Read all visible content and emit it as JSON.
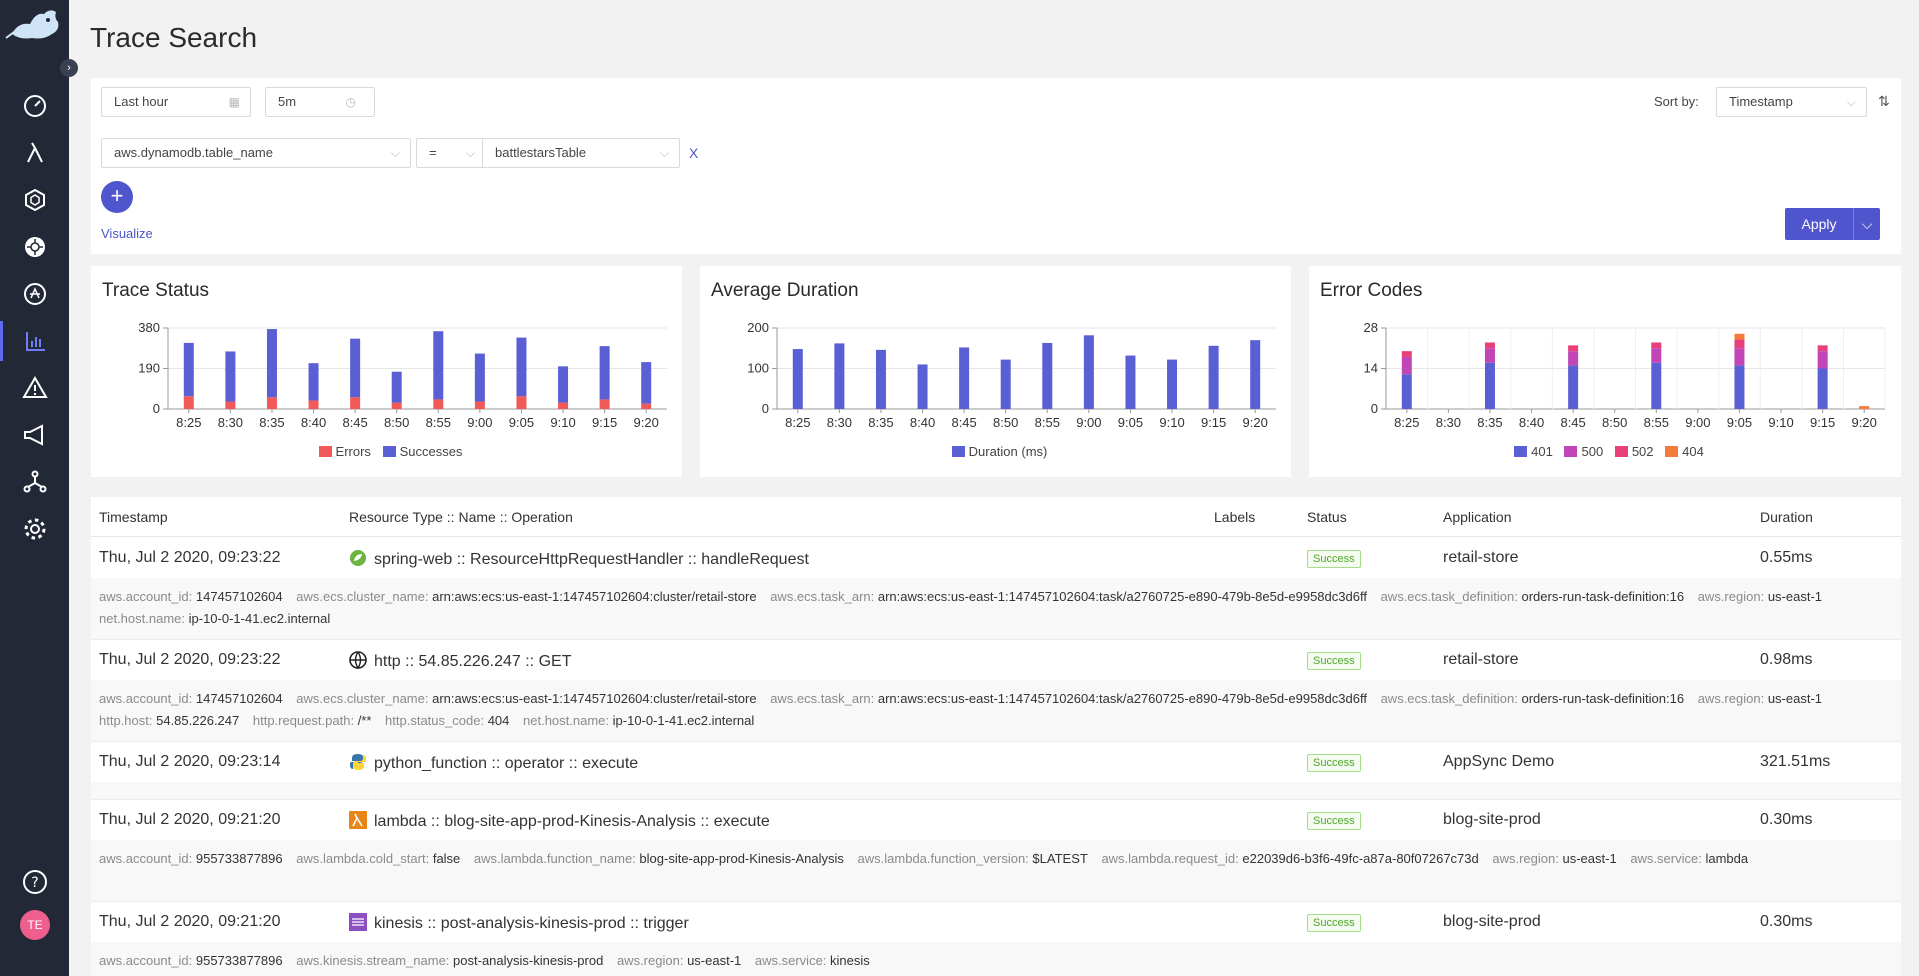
{
  "page": {
    "title": "Trace Search"
  },
  "filters": {
    "time_range": "Last hour",
    "interval": "5m",
    "sort_label": "Sort by:",
    "sort_value": "Timestamp",
    "attribute": "aws.dynamodb.table_name",
    "operator": "=",
    "value": "battlestarsTable",
    "clear": "X",
    "visualize_label": "Visualize",
    "apply_label": "Apply"
  },
  "user": {
    "initials": "TE"
  },
  "colors": {
    "accent": "#4f55cc",
    "errors": "#f25a5a",
    "successes": "#5b5fd4",
    "c401": "#5b5fd4",
    "c500": "#c145b6",
    "c502": "#e8407a",
    "c404": "#f47b3a"
  },
  "charts": {
    "times": [
      "8:25",
      "8:30",
      "8:35",
      "8:40",
      "8:45",
      "8:50",
      "8:55",
      "9:00",
      "9:05",
      "9:10",
      "9:15",
      "9:20"
    ],
    "trace_status": {
      "title": "Trace Status",
      "yticks": [
        "380",
        "190",
        "0"
      ],
      "legend": [
        "Errors",
        "Successes"
      ]
    },
    "avg_duration": {
      "title": "Average Duration",
      "yticks": [
        "200",
        "100",
        "0"
      ],
      "legend": [
        "Duration (ms)"
      ]
    },
    "error_codes": {
      "title": "Error Codes",
      "yticks": [
        "28",
        "14",
        "0"
      ],
      "legend": [
        "401",
        "500",
        "502",
        "404"
      ]
    }
  },
  "chart_data": [
    {
      "type": "bar",
      "title": "Trace Status",
      "categories": [
        "8:25",
        "8:30",
        "8:35",
        "8:40",
        "8:45",
        "8:50",
        "8:55",
        "9:00",
        "9:05",
        "9:10",
        "9:15",
        "9:20"
      ],
      "series": [
        {
          "name": "Errors",
          "values": [
            60,
            35,
            55,
            40,
            55,
            30,
            45,
            35,
            60,
            30,
            45,
            25
          ]
        },
        {
          "name": "Successes",
          "values": [
            250,
            235,
            320,
            175,
            275,
            145,
            320,
            225,
            275,
            170,
            250,
            195
          ]
        }
      ],
      "ylim": [
        0,
        380
      ]
    },
    {
      "type": "bar",
      "title": "Average Duration",
      "categories": [
        "8:25",
        "8:30",
        "8:35",
        "8:40",
        "8:45",
        "8:50",
        "8:55",
        "9:00",
        "9:05",
        "9:10",
        "9:15",
        "9:20"
      ],
      "series": [
        {
          "name": "Duration (ms)",
          "values": [
            148,
            162,
            146,
            110,
            152,
            122,
            163,
            182,
            132,
            122,
            156,
            170
          ]
        }
      ],
      "ylim": [
        0,
        200
      ]
    },
    {
      "type": "bar",
      "title": "Error Codes",
      "categories": [
        "8:25",
        "8:30",
        "8:35",
        "8:40",
        "8:45",
        "8:50",
        "8:55",
        "9:00",
        "9:05",
        "9:10",
        "9:15",
        "9:20"
      ],
      "series": [
        {
          "name": "401",
          "values": [
            12,
            0,
            16,
            0,
            15,
            0,
            16,
            0,
            15,
            0,
            14,
            0
          ]
        },
        {
          "name": "500",
          "values": [
            6,
            0,
            5,
            0,
            5,
            0,
            5,
            0,
            6,
            0,
            6,
            0
          ]
        },
        {
          "name": "502",
          "values": [
            2,
            0,
            2,
            0,
            2,
            0,
            2,
            0,
            3,
            0,
            2,
            0
          ]
        },
        {
          "name": "404",
          "values": [
            0,
            0,
            0,
            0,
            0,
            0,
            0,
            0,
            2,
            0,
            0,
            1
          ]
        }
      ],
      "ylim": [
        0,
        28
      ]
    }
  ],
  "table": {
    "headers": [
      "Timestamp",
      "Resource Type :: Name :: Operation",
      "Labels",
      "Status",
      "Application",
      "Duration"
    ],
    "rows": [
      {
        "timestamp": "Thu, Jul 2 2020, 09:23:22",
        "resource": "spring-web :: ResourceHttpRequestHandler :: handleRequest",
        "icon": "spring-icon",
        "status": "Success",
        "application": "retail-store",
        "duration": "0.55ms",
        "tags": [
          {
            "k": "aws.account_id:",
            "v": "147457102604"
          },
          {
            "k": "aws.ecs.cluster_name:",
            "v": "arn:aws:ecs:us-east-1:147457102604:cluster/retail-store"
          },
          {
            "k": "aws.ecs.task_arn:",
            "v": "arn:aws:ecs:us-east-1:147457102604:task/a2760725-e890-479b-8e5d-e9958dc3d6ff"
          },
          {
            "k": "aws.ecs.task_definition:",
            "v": "orders-run-task-definition:16"
          },
          {
            "k": "aws.region:",
            "v": "us-east-1"
          },
          {
            "k": "net.host.name:",
            "v": "ip-10-0-1-41.ec2.internal"
          }
        ]
      },
      {
        "timestamp": "Thu, Jul 2 2020, 09:23:22",
        "resource": "http :: 54.85.226.247 :: GET",
        "icon": "globe-icon",
        "status": "Success",
        "application": "retail-store",
        "duration": "0.98ms",
        "tags": [
          {
            "k": "aws.account_id:",
            "v": "147457102604"
          },
          {
            "k": "aws.ecs.cluster_name:",
            "v": "arn:aws:ecs:us-east-1:147457102604:cluster/retail-store"
          },
          {
            "k": "aws.ecs.task_arn:",
            "v": "arn:aws:ecs:us-east-1:147457102604:task/a2760725-e890-479b-8e5d-e9958dc3d6ff"
          },
          {
            "k": "aws.ecs.task_definition:",
            "v": "orders-run-task-definition:16"
          },
          {
            "k": "aws.region:",
            "v": "us-east-1"
          },
          {
            "k": "http.host:",
            "v": "54.85.226.247"
          },
          {
            "k": "http.request.path:",
            "v": "/**"
          },
          {
            "k": "http.status_code:",
            "v": "404"
          },
          {
            "k": "net.host.name:",
            "v": "ip-10-0-1-41.ec2.internal"
          }
        ]
      },
      {
        "timestamp": "Thu, Jul 2 2020, 09:23:14",
        "resource": "python_function :: operator :: execute",
        "icon": "python-icon",
        "status": "Success",
        "application": "AppSync Demo",
        "duration": "321.51ms",
        "tags": []
      },
      {
        "timestamp": "Thu, Jul 2 2020, 09:21:20",
        "resource": "lambda :: blog-site-app-prod-Kinesis-Analysis :: execute",
        "icon": "lambda-icon",
        "status": "Success",
        "application": "blog-site-prod",
        "duration": "0.30ms",
        "tags": [
          {
            "k": "aws.account_id:",
            "v": "955733877896"
          },
          {
            "k": "aws.lambda.cold_start:",
            "v": "false"
          },
          {
            "k": "aws.lambda.function_name:",
            "v": "blog-site-app-prod-Kinesis-Analysis"
          },
          {
            "k": "aws.lambda.function_version:",
            "v": "$LATEST"
          },
          {
            "k": "aws.lambda.request_id:",
            "v": "e22039d6-b3f6-49fc-a87a-80f07267c73d"
          },
          {
            "k": "aws.region:",
            "v": "us-east-1"
          },
          {
            "k": "aws.service:",
            "v": "lambda"
          }
        ]
      },
      {
        "timestamp": "Thu, Jul 2 2020, 09:21:20",
        "resource": "kinesis :: post-analysis-kinesis-prod :: trigger",
        "icon": "kinesis-icon",
        "status": "Success",
        "application": "blog-site-prod",
        "duration": "0.30ms",
        "tags": [
          {
            "k": "aws.account_id:",
            "v": "955733877896"
          },
          {
            "k": "aws.kinesis.stream_name:",
            "v": "post-analysis-kinesis-prod"
          },
          {
            "k": "aws.region:",
            "v": "us-east-1"
          },
          {
            "k": "aws.service:",
            "v": "kinesis"
          }
        ]
      }
    ]
  }
}
